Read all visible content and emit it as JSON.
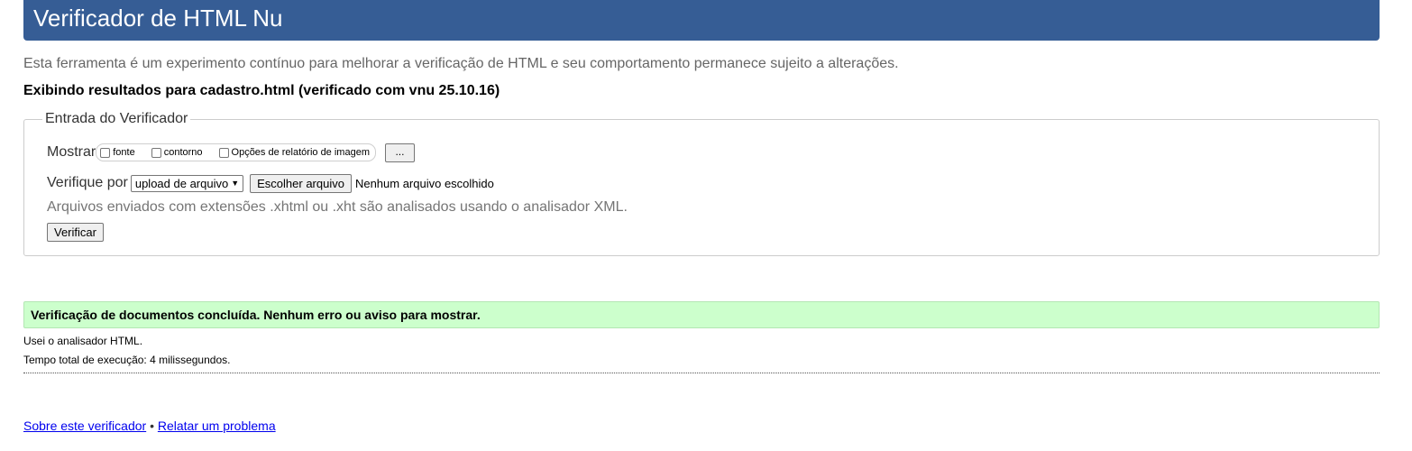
{
  "header": {
    "title": "Verificador de HTML Nu"
  },
  "intro": {
    "text": "Esta ferramenta é um experimento contínuo para melhorar a verificação de HTML e seu comportamento permanece sujeito a alterações."
  },
  "results": {
    "heading": "Exibindo resultados para cadastro.html (verificado com vnu 25.10.16)"
  },
  "checker_input": {
    "legend": "Entrada do Verificador",
    "show_label": "Mostrar",
    "options": [
      {
        "label": "fonte",
        "checked": false
      },
      {
        "label": "contorno",
        "checked": false
      },
      {
        "label": "Opções de relatório de imagem",
        "checked": false
      }
    ],
    "more_button": "...",
    "check_by_label": "Verifique por",
    "check_by_value": "upload de arquivo",
    "file_button": "Escolher arquivo",
    "file_status": "Nenhum arquivo escolhido",
    "xml_note": "Arquivos enviados com extensões .xhtml ou .xht são analisados usando o analisador XML.",
    "submit_label": "Verificar"
  },
  "outcome": {
    "message": "Verificação de documentos concluída. Nenhum erro ou aviso para mostrar.",
    "parser": "Usei o analisador HTML.",
    "elapsed": "Tempo total de execução: 4 milissegundos."
  },
  "footer": {
    "about_link": "Sobre este verificador",
    "separator": "•",
    "report_link": "Relatar um problema"
  },
  "colors": {
    "header_bg": "#365d95",
    "success_bg": "#ccffcc",
    "link": "#0000ee"
  }
}
